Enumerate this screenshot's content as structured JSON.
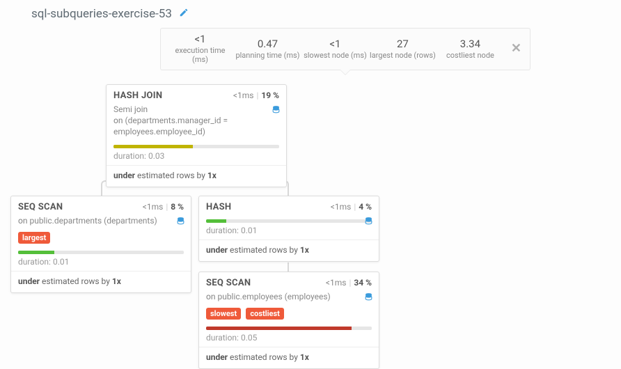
{
  "title": "sql-subqueries-exercise-53",
  "stats": {
    "execution_time": {
      "value": "<1",
      "label": "execution time (ms)"
    },
    "planning_time": {
      "value": "0.47",
      "label": "planning time (ms)"
    },
    "slowest_node": {
      "value": "<1",
      "label": "slowest node (ms)"
    },
    "largest_node": {
      "value": "27",
      "label": "largest node (rows)"
    },
    "costliest_node": {
      "value": "3.34",
      "label": "costliest node"
    }
  },
  "nodes": {
    "hash_join": {
      "name": "HASH JOIN",
      "time": "<1ms",
      "pct": "19 %",
      "desc_prefix": "Semi ",
      "desc_join_kw": "join",
      "desc_on_kw": "on",
      "desc_cond": " (departments.manager_id = employees.employee_id)",
      "bar_color": "#c0b400",
      "bar_pct": 48,
      "duration_label": "duration: ",
      "duration_val": "0.03",
      "est_prefix": "under",
      "est_mid": " estimated rows by ",
      "est_factor": "1x"
    },
    "seq_scan_dept": {
      "name": "SEQ SCAN",
      "time": "<1ms",
      "pct": "8 %",
      "desc_on_kw": "on",
      "desc_rel": " public.departments (departments)",
      "badge_largest": "largest",
      "bar_color": "#54bf3a",
      "bar_pct": 22,
      "duration_label": "duration: ",
      "duration_val": "0.01",
      "est_prefix": "under",
      "est_mid": " estimated rows by ",
      "est_factor": "1x"
    },
    "hash": {
      "name": "HASH",
      "time": "<1ms",
      "pct": "4 %",
      "bar_color": "#54bf3a",
      "bar_pct": 12,
      "duration_label": "duration: ",
      "duration_val": "0.01",
      "est_prefix": "under",
      "est_mid": " estimated rows by ",
      "est_factor": "1x"
    },
    "seq_scan_emp": {
      "name": "SEQ SCAN",
      "time": "<1ms",
      "pct": "34 %",
      "desc_on_kw": "on",
      "desc_rel": " public.employees (employees)",
      "badge_slowest": "slowest",
      "badge_costliest": "costliest",
      "bar_color": "#c0392b",
      "bar_pct": 88,
      "duration_label": "duration: ",
      "duration_val": "0.05",
      "est_prefix": "under",
      "est_mid": " estimated rows by ",
      "est_factor": "1x"
    }
  }
}
